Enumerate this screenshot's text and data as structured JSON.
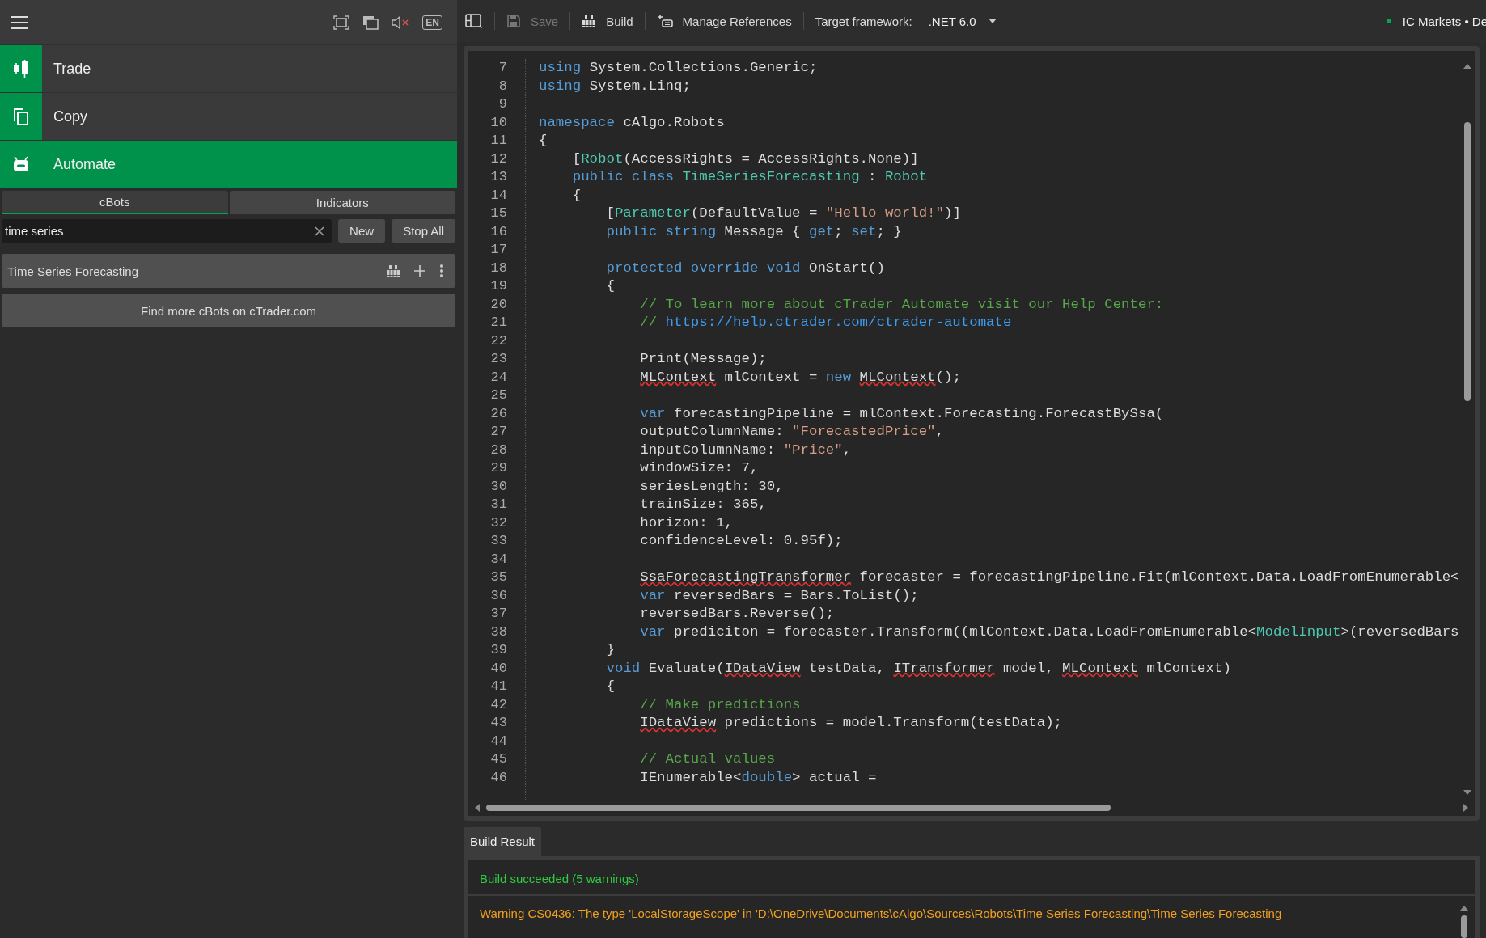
{
  "sidebar": {
    "language": "EN",
    "nav": [
      {
        "kind": "candles",
        "label": "Trade",
        "selected": false
      },
      {
        "kind": "pages",
        "label": "Copy",
        "selected": false
      },
      {
        "kind": "robot",
        "label": "Automate",
        "selected": true
      }
    ],
    "tabs": [
      {
        "label": "cBots",
        "selected": true
      },
      {
        "label": "Indicators",
        "selected": false
      }
    ],
    "search": {
      "value": "time series"
    },
    "buttons": [
      "New",
      "Stop All"
    ],
    "items": [
      {
        "label": "Time Series Forecasting"
      }
    ],
    "more_button": "Find more cBots on cTrader.com"
  },
  "toolbar": {
    "items": [
      {
        "kind": "layout"
      },
      {
        "kind": "save",
        "label": "Save",
        "disabled": true
      },
      {
        "kind": "build",
        "label": "Build",
        "disabled": false
      },
      {
        "kind": "references",
        "label": "Manage References",
        "disabled": false
      }
    ],
    "framework_label": "Target framework:",
    "framework": ".NET 6.0",
    "account": "IC Markets • De",
    "connected": true
  },
  "editor": {
    "lines": [
      {
        "number": "7",
        "tokens": [
          {
            "kind": "kw",
            "text": "using"
          },
          {
            "kind": "plain",
            "text": " System.Collections.Generic;"
          }
        ]
      },
      {
        "number": "8",
        "tokens": [
          {
            "kind": "kw",
            "text": "using"
          },
          {
            "kind": "plain",
            "text": " System.Linq;"
          }
        ]
      },
      {
        "number": "9"
      },
      {
        "number": "10",
        "tokens": [
          {
            "kind": "kw",
            "text": "namespace"
          },
          {
            "kind": "plain",
            "text": " cAlgo.Robots"
          }
        ]
      },
      {
        "number": "11",
        "tokens": [
          {
            "kind": "plain",
            "text": "{"
          }
        ]
      },
      {
        "number": "12",
        "tokens": [
          {
            "kind": "plain",
            "text": "    ["
          },
          {
            "kind": "type",
            "text": "Robot"
          },
          {
            "kind": "plain",
            "text": "(AccessRights = AccessRights.None)]"
          }
        ]
      },
      {
        "number": "13",
        "tokens": [
          {
            "kind": "kw",
            "text": "    public class"
          },
          {
            "kind": "type",
            "text": " TimeSeriesForecasting"
          },
          {
            "kind": "plain",
            "text": " : "
          },
          {
            "kind": "type",
            "text": "Robot"
          }
        ]
      },
      {
        "number": "14",
        "tokens": [
          {
            "kind": "plain",
            "text": "    {"
          }
        ]
      },
      {
        "number": "15",
        "tokens": [
          {
            "kind": "plain",
            "text": "        ["
          },
          {
            "kind": "type",
            "text": "Parameter"
          },
          {
            "kind": "plain",
            "text": "(DefaultValue = "
          },
          {
            "kind": "str",
            "text": "\"Hello world!\""
          },
          {
            "kind": "plain",
            "text": ")]"
          }
        ]
      },
      {
        "number": "16",
        "tokens": [
          {
            "kind": "kw",
            "text": "        public string"
          },
          {
            "kind": "plain",
            "text": " Message { "
          },
          {
            "kind": "kw",
            "text": "get"
          },
          {
            "kind": "plain",
            "text": "; "
          },
          {
            "kind": "kw",
            "text": "set"
          },
          {
            "kind": "plain",
            "text": "; }"
          }
        ]
      },
      {
        "number": "17"
      },
      {
        "number": "18",
        "tokens": [
          {
            "kind": "kw",
            "text": "        protected override void"
          },
          {
            "kind": "plain",
            "text": " OnStart()"
          }
        ]
      },
      {
        "number": "19",
        "tokens": [
          {
            "kind": "plain",
            "text": "        {"
          }
        ]
      },
      {
        "number": "20",
        "tokens": [
          {
            "kind": "comment",
            "text": "            // To learn more about cTrader Automate visit our Help Center:"
          }
        ]
      },
      {
        "number": "21",
        "tokens": [
          {
            "kind": "comment",
            "text": "            // "
          },
          {
            "kind": "link",
            "text": "https://help.ctrader.com/ctrader-automate"
          }
        ]
      },
      {
        "number": "22"
      },
      {
        "number": "23",
        "tokens": [
          {
            "kind": "plain",
            "text": "            Print(Message);"
          }
        ]
      },
      {
        "number": "24",
        "tokens": [
          {
            "kind": "err",
            "text": "            MLContext"
          },
          {
            "kind": "plain",
            "text": " mlContext = "
          },
          {
            "kind": "kw",
            "text": "new "
          },
          {
            "kind": "err",
            "text": "MLContext"
          },
          {
            "kind": "plain",
            "text": "();"
          }
        ]
      },
      {
        "number": "25"
      },
      {
        "number": "26",
        "tokens": [
          {
            "kind": "kw",
            "text": "            var"
          },
          {
            "kind": "plain",
            "text": " forecastingPipeline = mlContext.Forecasting.ForecastBySsa("
          }
        ]
      },
      {
        "number": "27",
        "tokens": [
          {
            "kind": "plain",
            "text": "            outputColumnName: "
          },
          {
            "kind": "str",
            "text": "\"ForecastedPrice\""
          },
          {
            "kind": "plain",
            "text": ","
          }
        ]
      },
      {
        "number": "28",
        "tokens": [
          {
            "kind": "plain",
            "text": "            inputColumnName: "
          },
          {
            "kind": "str",
            "text": "\"Price\""
          },
          {
            "kind": "plain",
            "text": ","
          }
        ]
      },
      {
        "number": "29",
        "tokens": [
          {
            "kind": "plain",
            "text": "            windowSize: 7,"
          }
        ]
      },
      {
        "number": "30",
        "tokens": [
          {
            "kind": "plain",
            "text": "            seriesLength: 30,"
          }
        ]
      },
      {
        "number": "31",
        "tokens": [
          {
            "kind": "plain",
            "text": "            trainSize: 365,"
          }
        ]
      },
      {
        "number": "32",
        "tokens": [
          {
            "kind": "plain",
            "text": "            horizon: 1,"
          }
        ]
      },
      {
        "number": "33",
        "tokens": [
          {
            "kind": "plain",
            "text": "            confidenceLevel: 0.95f);"
          }
        ]
      },
      {
        "number": "34"
      },
      {
        "number": "35",
        "tokens": [
          {
            "kind": "err",
            "text": "            SsaForecastingTransformer"
          },
          {
            "kind": "plain",
            "text": " forecaster = forecastingPipeline.Fit(mlContext.Data.LoadFromEnumerable<"
          }
        ]
      },
      {
        "number": "36",
        "tokens": [
          {
            "kind": "kw",
            "text": "            var"
          },
          {
            "kind": "plain",
            "text": " reversedBars = Bars.ToList();"
          }
        ]
      },
      {
        "number": "37",
        "tokens": [
          {
            "kind": "plain",
            "text": "            reversedBars.Reverse();"
          }
        ]
      },
      {
        "number": "38",
        "tokens": [
          {
            "kind": "kw",
            "text": "            var"
          },
          {
            "kind": "plain",
            "text": " prediciton = forecaster.Transform((mlContext.Data.LoadFromEnumerable<"
          },
          {
            "kind": "type",
            "text": "ModelInput"
          },
          {
            "kind": "plain",
            "text": ">(reversedBars"
          }
        ]
      },
      {
        "number": "39",
        "tokens": [
          {
            "kind": "plain",
            "text": "        }"
          }
        ]
      },
      {
        "number": "40",
        "tokens": [
          {
            "kind": "kw",
            "text": "        void"
          },
          {
            "kind": "plain",
            "text": " Evaluate("
          },
          {
            "kind": "err",
            "text": "IDataView"
          },
          {
            "kind": "plain",
            "text": " testData, "
          },
          {
            "kind": "err",
            "text": "ITransformer"
          },
          {
            "kind": "plain",
            "text": " model, "
          },
          {
            "kind": "err",
            "text": "MLContext"
          },
          {
            "kind": "plain",
            "text": " mlContext)"
          }
        ]
      },
      {
        "number": "41",
        "tokens": [
          {
            "kind": "plain",
            "text": "        {"
          }
        ]
      },
      {
        "number": "42",
        "tokens": [
          {
            "kind": "comment",
            "text": "            // Make predictions"
          }
        ]
      },
      {
        "number": "43",
        "tokens": [
          {
            "kind": "err",
            "text": "            IDataView"
          },
          {
            "kind": "plain",
            "text": " predictions = model.Transform(testData);"
          }
        ]
      },
      {
        "number": "44"
      },
      {
        "number": "45",
        "tokens": [
          {
            "kind": "comment",
            "text": "            // Actual values"
          }
        ]
      },
      {
        "number": "46",
        "tokens": [
          {
            "kind": "plain",
            "text": "            IEnumerable<"
          },
          {
            "kind": "kw",
            "text": "double"
          },
          {
            "kind": "plain",
            "text": "> actual ="
          }
        ]
      }
    ]
  },
  "build": {
    "tab": "Build Result",
    "status": "Build succeeded (5 warnings)",
    "messages": [
      "Warning CS0436: The type 'LocalStorageScope' in 'D:\\OneDrive\\Documents\\cAlgo\\Sources\\Robots\\Time Series Forecasting\\Time Series Forecasting"
    ]
  }
}
